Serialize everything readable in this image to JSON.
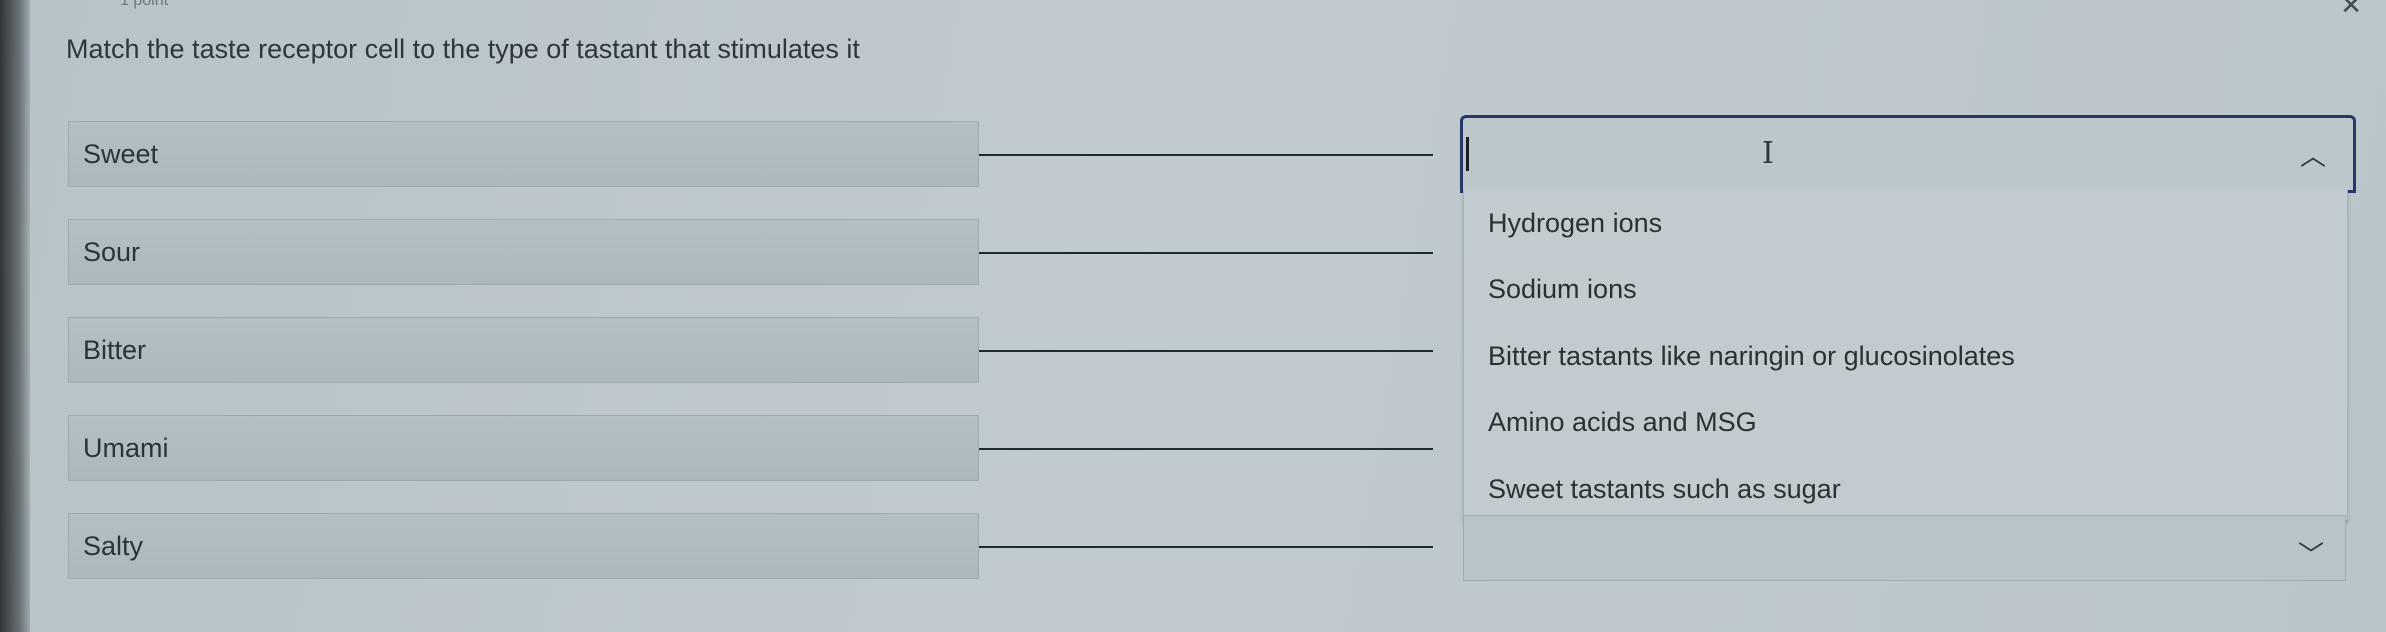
{
  "header": {
    "top_hint": "1 point",
    "question": "Match the taste receptor cell to the type of tastant that stimulates it"
  },
  "terms": [
    {
      "label": "Sweet"
    },
    {
      "label": "Sour"
    },
    {
      "label": "Bitter"
    },
    {
      "label": "Umami"
    },
    {
      "label": "Salty"
    }
  ],
  "dropdown": {
    "value": "",
    "options": [
      "Hydrogen ions",
      "Sodium ions",
      "Bitter tastants like naringin or glucosinolates",
      "Amino acids and MSG",
      "Sweet tastants such as sugar"
    ]
  },
  "icons": {
    "close": "close-icon",
    "dropdown_open": "chevron-up-icon",
    "dropdown_closed": "chevron-down-icon",
    "cursor": "text-cursor-icon"
  },
  "colors": {
    "focus_border": "#26386a",
    "text": "#2c3338",
    "background": "#bcc7cc"
  }
}
